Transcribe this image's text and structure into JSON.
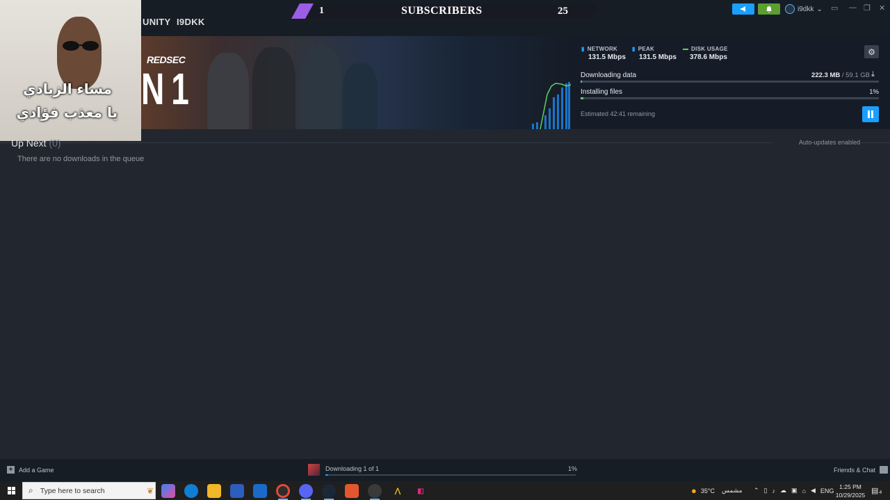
{
  "titlebar": {
    "nav_community": "UNITY",
    "nav_user": "I9DKK",
    "username": "i9dkk",
    "announce_icon": "megaphone-icon",
    "notify_icon": "bell-icon",
    "colors": {
      "announce": "#1a9fff",
      "notify": "#5c9e31"
    }
  },
  "overlay": {
    "subs_left": "1",
    "subs_title": "SUBSCRIBERS",
    "subs_right": "25",
    "webcam_line1": "مساء الزبادي",
    "webcam_line2": "يا معذب فؤادي"
  },
  "hero": {
    "logo_small": "REDSEC",
    "logo_big": "N 1",
    "stats": [
      {
        "label": "NETWORK",
        "value": "131.5 Mbps"
      },
      {
        "label": "PEAK",
        "value": "131.5 Mbps"
      },
      {
        "label": "DISK USAGE",
        "value": "378.6 Mbps"
      }
    ],
    "downloading_label": "Downloading data",
    "downloaded_amount": "222.3 MB",
    "total_size": "/ 59.1 GB",
    "installing_label": "Installing files",
    "installing_pct": "1%",
    "installing_progress": 0.01,
    "download_progress": 0.004,
    "remaining": "Estimated 42:41 remaining"
  },
  "queue": {
    "title": "Up Next",
    "count": "(0)",
    "empty_message": "There are no downloads in the queue",
    "auto_updates": "Auto-updates enabled"
  },
  "bottombar": {
    "add_game": "Add a Game",
    "download_status": "Downloading 1 of 1",
    "download_pct": "1%",
    "download_progress": 0.01,
    "friends": "Friends & Chat"
  },
  "taskbar": {
    "search_placeholder": "Type here to search",
    "weather_temp": "35°C",
    "weather_text": "مشمس",
    "language": "ENG",
    "time": "1:25 PM",
    "date": "10/29/2025",
    "notification_count": "4"
  }
}
